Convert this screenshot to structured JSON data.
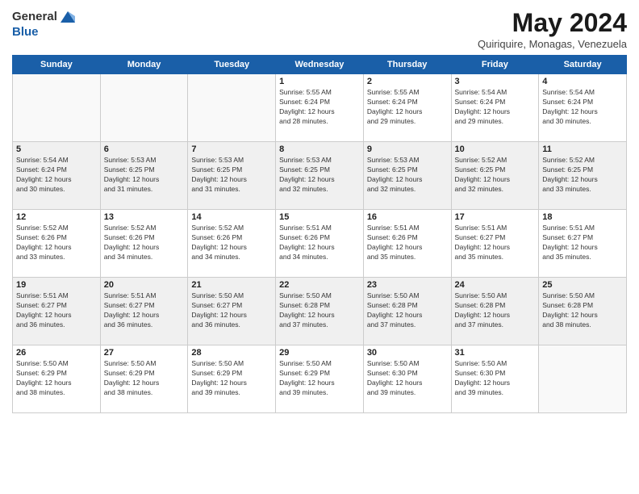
{
  "header": {
    "logo_line1": "General",
    "logo_line2": "Blue",
    "month": "May 2024",
    "location": "Quiriquire, Monagas, Venezuela"
  },
  "weekdays": [
    "Sunday",
    "Monday",
    "Tuesday",
    "Wednesday",
    "Thursday",
    "Friday",
    "Saturday"
  ],
  "weeks": [
    [
      {
        "day": "",
        "info": ""
      },
      {
        "day": "",
        "info": ""
      },
      {
        "day": "",
        "info": ""
      },
      {
        "day": "1",
        "info": "Sunrise: 5:55 AM\nSunset: 6:24 PM\nDaylight: 12 hours\nand 28 minutes."
      },
      {
        "day": "2",
        "info": "Sunrise: 5:55 AM\nSunset: 6:24 PM\nDaylight: 12 hours\nand 29 minutes."
      },
      {
        "day": "3",
        "info": "Sunrise: 5:54 AM\nSunset: 6:24 PM\nDaylight: 12 hours\nand 29 minutes."
      },
      {
        "day": "4",
        "info": "Sunrise: 5:54 AM\nSunset: 6:24 PM\nDaylight: 12 hours\nand 30 minutes."
      }
    ],
    [
      {
        "day": "5",
        "info": "Sunrise: 5:54 AM\nSunset: 6:24 PM\nDaylight: 12 hours\nand 30 minutes."
      },
      {
        "day": "6",
        "info": "Sunrise: 5:53 AM\nSunset: 6:25 PM\nDaylight: 12 hours\nand 31 minutes."
      },
      {
        "day": "7",
        "info": "Sunrise: 5:53 AM\nSunset: 6:25 PM\nDaylight: 12 hours\nand 31 minutes."
      },
      {
        "day": "8",
        "info": "Sunrise: 5:53 AM\nSunset: 6:25 PM\nDaylight: 12 hours\nand 32 minutes."
      },
      {
        "day": "9",
        "info": "Sunrise: 5:53 AM\nSunset: 6:25 PM\nDaylight: 12 hours\nand 32 minutes."
      },
      {
        "day": "10",
        "info": "Sunrise: 5:52 AM\nSunset: 6:25 PM\nDaylight: 12 hours\nand 32 minutes."
      },
      {
        "day": "11",
        "info": "Sunrise: 5:52 AM\nSunset: 6:25 PM\nDaylight: 12 hours\nand 33 minutes."
      }
    ],
    [
      {
        "day": "12",
        "info": "Sunrise: 5:52 AM\nSunset: 6:26 PM\nDaylight: 12 hours\nand 33 minutes."
      },
      {
        "day": "13",
        "info": "Sunrise: 5:52 AM\nSunset: 6:26 PM\nDaylight: 12 hours\nand 34 minutes."
      },
      {
        "day": "14",
        "info": "Sunrise: 5:52 AM\nSunset: 6:26 PM\nDaylight: 12 hours\nand 34 minutes."
      },
      {
        "day": "15",
        "info": "Sunrise: 5:51 AM\nSunset: 6:26 PM\nDaylight: 12 hours\nand 34 minutes."
      },
      {
        "day": "16",
        "info": "Sunrise: 5:51 AM\nSunset: 6:26 PM\nDaylight: 12 hours\nand 35 minutes."
      },
      {
        "day": "17",
        "info": "Sunrise: 5:51 AM\nSunset: 6:27 PM\nDaylight: 12 hours\nand 35 minutes."
      },
      {
        "day": "18",
        "info": "Sunrise: 5:51 AM\nSunset: 6:27 PM\nDaylight: 12 hours\nand 35 minutes."
      }
    ],
    [
      {
        "day": "19",
        "info": "Sunrise: 5:51 AM\nSunset: 6:27 PM\nDaylight: 12 hours\nand 36 minutes."
      },
      {
        "day": "20",
        "info": "Sunrise: 5:51 AM\nSunset: 6:27 PM\nDaylight: 12 hours\nand 36 minutes."
      },
      {
        "day": "21",
        "info": "Sunrise: 5:50 AM\nSunset: 6:27 PM\nDaylight: 12 hours\nand 36 minutes."
      },
      {
        "day": "22",
        "info": "Sunrise: 5:50 AM\nSunset: 6:28 PM\nDaylight: 12 hours\nand 37 minutes."
      },
      {
        "day": "23",
        "info": "Sunrise: 5:50 AM\nSunset: 6:28 PM\nDaylight: 12 hours\nand 37 minutes."
      },
      {
        "day": "24",
        "info": "Sunrise: 5:50 AM\nSunset: 6:28 PM\nDaylight: 12 hours\nand 37 minutes."
      },
      {
        "day": "25",
        "info": "Sunrise: 5:50 AM\nSunset: 6:28 PM\nDaylight: 12 hours\nand 38 minutes."
      }
    ],
    [
      {
        "day": "26",
        "info": "Sunrise: 5:50 AM\nSunset: 6:29 PM\nDaylight: 12 hours\nand 38 minutes."
      },
      {
        "day": "27",
        "info": "Sunrise: 5:50 AM\nSunset: 6:29 PM\nDaylight: 12 hours\nand 38 minutes."
      },
      {
        "day": "28",
        "info": "Sunrise: 5:50 AM\nSunset: 6:29 PM\nDaylight: 12 hours\nand 39 minutes."
      },
      {
        "day": "29",
        "info": "Sunrise: 5:50 AM\nSunset: 6:29 PM\nDaylight: 12 hours\nand 39 minutes."
      },
      {
        "day": "30",
        "info": "Sunrise: 5:50 AM\nSunset: 6:30 PM\nDaylight: 12 hours\nand 39 minutes."
      },
      {
        "day": "31",
        "info": "Sunrise: 5:50 AM\nSunset: 6:30 PM\nDaylight: 12 hours\nand 39 minutes."
      },
      {
        "day": "",
        "info": ""
      }
    ]
  ]
}
